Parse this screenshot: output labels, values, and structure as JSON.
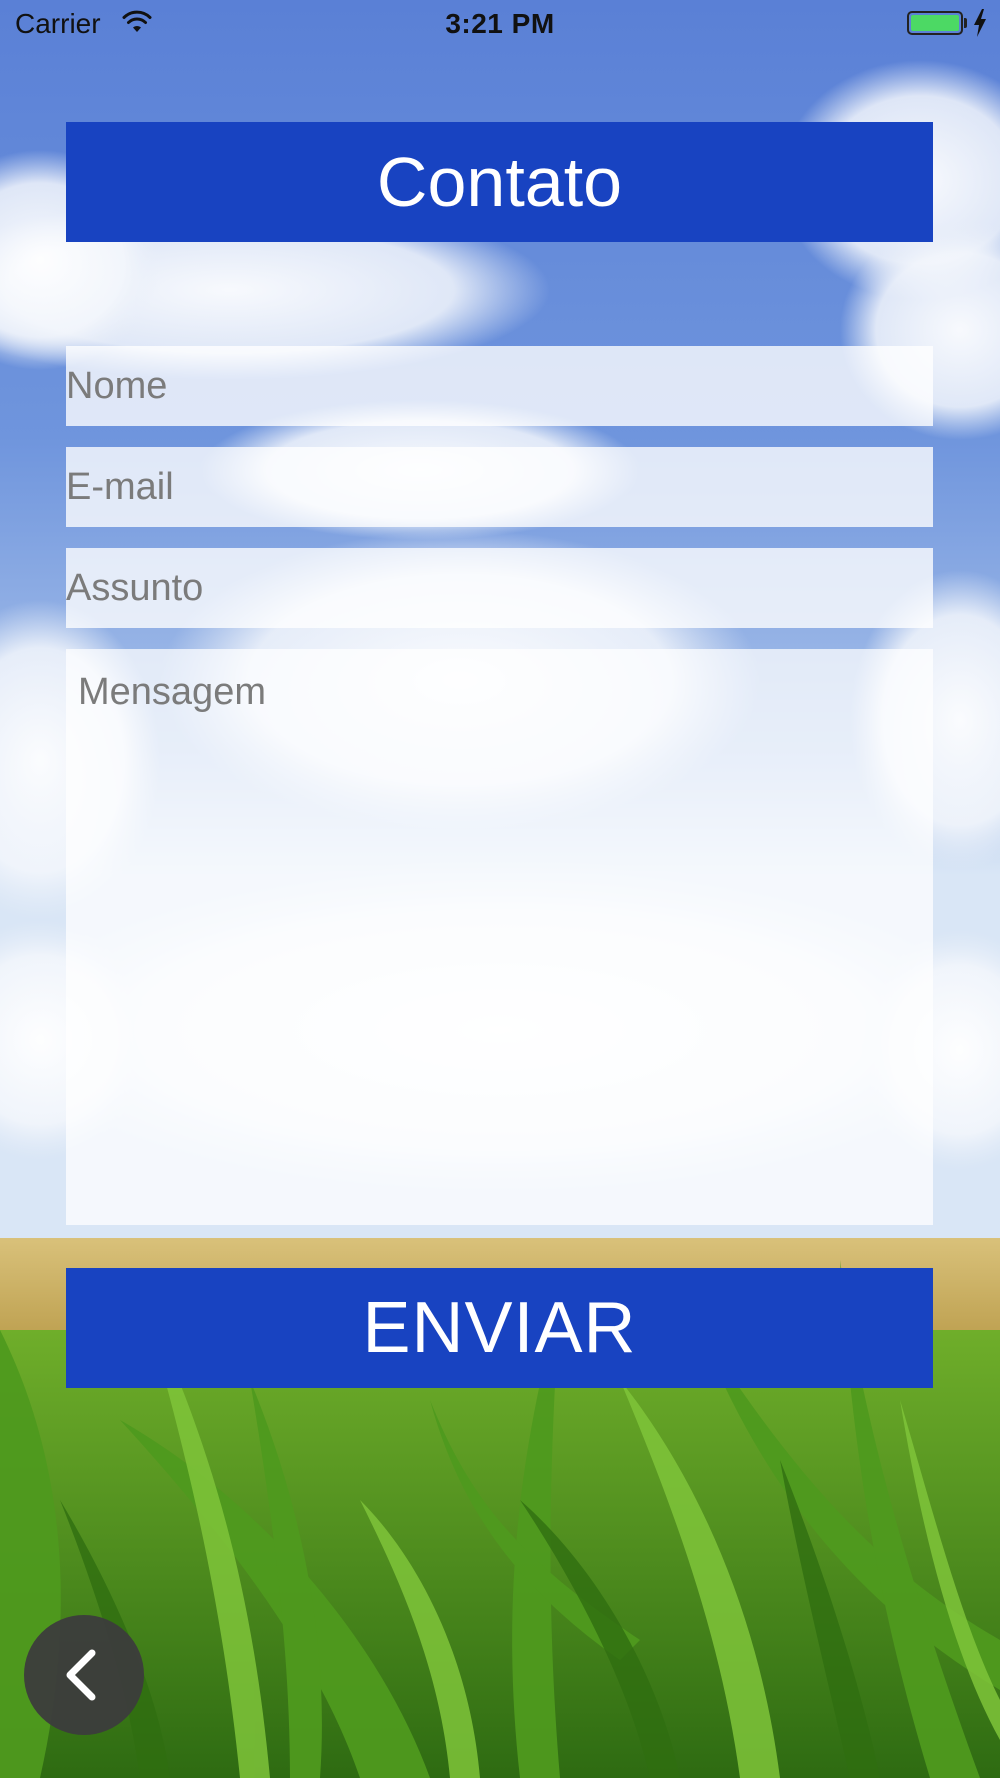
{
  "status_bar": {
    "carrier": "Carrier",
    "time": "3:21 PM",
    "battery_level": 1.0
  },
  "header": {
    "title": "Contato"
  },
  "form": {
    "name_placeholder": "Nome",
    "email_placeholder": "E-mail",
    "subject_placeholder": "Assunto",
    "message_placeholder": "Mensagem",
    "submit_label": "ENVIAR"
  },
  "navigation": {
    "back_icon": "chevron-left-icon"
  },
  "colors": {
    "primary": "#1843c1",
    "sky": "#5f86d8",
    "back_button": "#3c3c3c"
  }
}
